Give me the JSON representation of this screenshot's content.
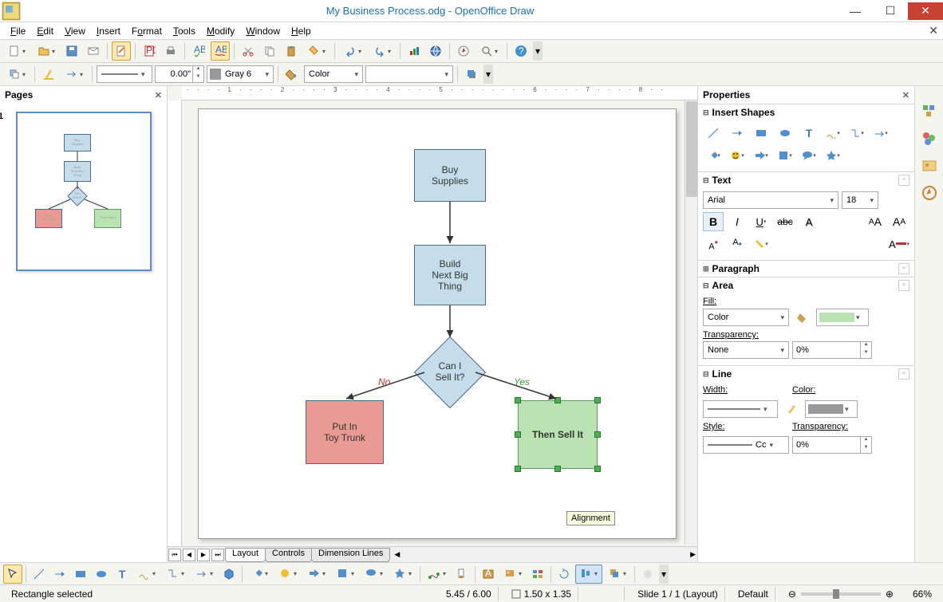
{
  "title": "My Business Process.odg - OpenOffice Draw",
  "menus": [
    "File",
    "Edit",
    "View",
    "Insert",
    "Format",
    "Tools",
    "Modify",
    "Window",
    "Help"
  ],
  "toolbar2": {
    "line_width": "0.00\"",
    "line_color_label": "Gray 6",
    "area_label": "Color"
  },
  "pages": {
    "title": "Pages",
    "page_num": "1"
  },
  "canvas": {
    "tabs": [
      "Layout",
      "Controls",
      "Dimension Lines"
    ],
    "tooltip": "Alignment",
    "shapes": {
      "buy": "Buy\nSupplies",
      "build": "Build\nNext Big\nThing",
      "decision": "Can I\nSell It?",
      "left": "Put In\nToy Trunk",
      "right": "Then Sell It",
      "no": "No",
      "yes": "Yes"
    }
  },
  "props": {
    "title": "Properties",
    "shapes": "Insert Shapes",
    "text": "Text",
    "font": "Arial",
    "size": "18",
    "paragraph": "Paragraph",
    "area": "Area",
    "fill_label": "Fill:",
    "fill_type": "Color",
    "transparency_label": "Transparency:",
    "transparency_type": "None",
    "transparency_val": "0%",
    "line": "Line",
    "width_label": "Width:",
    "color_label": "Color:",
    "style_label": "Style:",
    "style_val": "Cc",
    "line_trans": "Transparency:",
    "line_trans_val": "0%"
  },
  "status": {
    "sel": "Rectangle selected",
    "pos": "5.45 / 6.00",
    "size": "1.50 x 1.35",
    "slide": "Slide 1 / 1 (Layout)",
    "style": "Default",
    "zoom": "66%"
  }
}
